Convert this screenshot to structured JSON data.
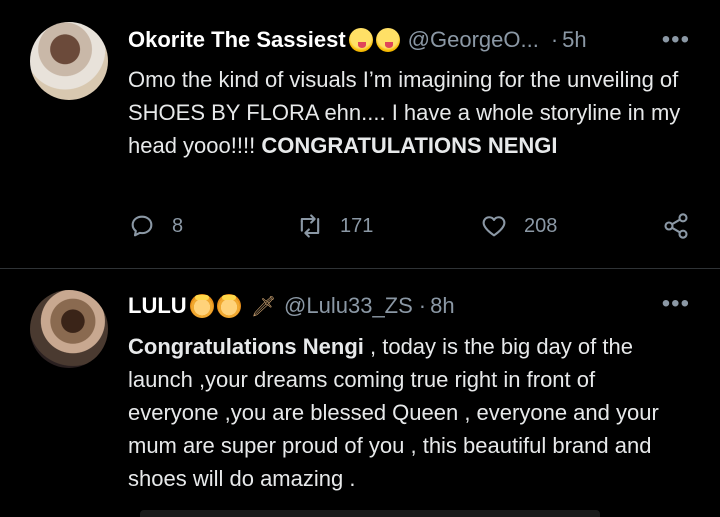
{
  "tweets": [
    {
      "name": "Okorite The Sassiest",
      "handle": "@GeorgeO...",
      "time": "5h",
      "text_normal": "Omo the kind of visuals I’m imagining for the unveiling of SHOES BY FLORA ehn.... I have a whole storyline in my head yooo!!!! ",
      "text_bold": "CONGRATULATIONS NENGI",
      "reply_count": "8",
      "retweet_count": "171",
      "like_count": "208"
    },
    {
      "name": "LULU",
      "handle": "@Lulu33_ZS",
      "time": "8h",
      "text_bold": "Congratulations Nengi",
      "text_normal": " , today is the big day of the launch ,your dreams coming true right in front of everyone ,you are blessed Queen , everyone and your mum are super proud of you , this beautiful brand and shoes will do amazing ."
    }
  ],
  "icons": {
    "reply": "reply-icon",
    "retweet": "retweet-icon",
    "like": "heart-icon",
    "share": "share-icon",
    "more": "more-icon"
  },
  "colors": {
    "background": "#000000",
    "text": "#e7e9ea",
    "muted": "#8b98a5",
    "divider": "#2f3336"
  }
}
